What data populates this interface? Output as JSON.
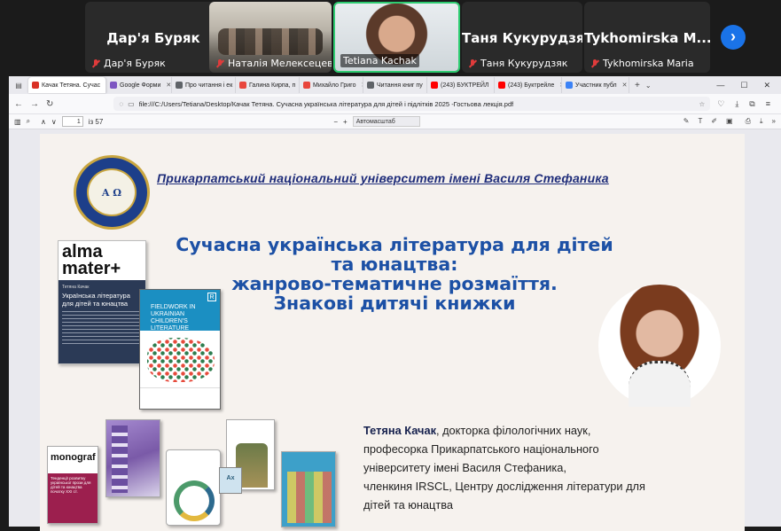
{
  "meeting": {
    "tiles": [
      {
        "display_name": "Дар'я Буряк",
        "caption": "Дар'я Буряк",
        "muted": true
      },
      {
        "display_name": "",
        "caption": "Наталія Мелексецева",
        "muted": true
      },
      {
        "display_name": "",
        "caption": "Tetiana Kachak",
        "muted": false,
        "active": true
      },
      {
        "display_name": "Таня Кукурудзяк",
        "caption": "Таня Кукурудзяк",
        "muted": true
      },
      {
        "display_name": "Tykhomirska M...",
        "caption": "Tykhomirska Maria",
        "muted": true
      }
    ],
    "next_icon": "chevron-right-icon"
  },
  "browser": {
    "tabs": [
      {
        "label": "Качак Тетяна. Сучас",
        "fav_color": "#d93025",
        "active": true
      },
      {
        "label": "Google Форми",
        "fav_color": "#7e57c2"
      },
      {
        "label": "Про читання і ек",
        "fav_color": "#5f6368"
      },
      {
        "label": "Галина Кирпа, п",
        "fav_color": "#e8453c"
      },
      {
        "label": "Михайло Григо",
        "fav_color": "#e8453c"
      },
      {
        "label": "Читання книг пу",
        "fav_color": "#5f6368"
      },
      {
        "label": "(243) БУКТРЕЙЛ",
        "fav_color": "#ff0000"
      },
      {
        "label": "(243) Буктрейле",
        "fav_color": "#ff0000"
      },
      {
        "label": "Участник публ",
        "fav_color": "#3b82f6"
      }
    ],
    "new_tab": "+",
    "url": "file:///C:/Users/Tetiana/Desktop/Качак Тетяна. Сучасна українська література для дітей і підлітків 2025 -Гостьова лекція.pdf",
    "pdf": {
      "page": "1",
      "of_pages": "із 57",
      "zoom_minus": "−",
      "zoom_plus": "+",
      "zoom": "Автомасштаб"
    }
  },
  "slide": {
    "university": "Прикарпатський національний університет імені Василя Стефаника",
    "seal_text": "Α Ω",
    "title_lines": [
      "Сучасна українська література для дітей",
      "та юнацтва:",
      "жанрово-тематичне розмаїття.",
      "Знакові дитячі книжки"
    ],
    "book1": {
      "brand_line1": "alma",
      "brand_line2": "mater+",
      "author": "Тетяна Качак",
      "title": "Українська література для дітей та юнацтва"
    },
    "book2": {
      "title": "Fieldwork in Ukrainian Children's Literature",
      "logo": "R"
    },
    "book_small": {
      "brand": "monograf",
      "title": "Тенденції розвитку української прози для дітей та юнацтва початку XXI ст."
    },
    "book_mini": "Ax",
    "author": {
      "name": "Тетяна Качак",
      "line1_rest": ", докторка філологічних наук,",
      "line2": "професорка Прикарпатського національного",
      "line3": "університету імені Василя Стефаника,",
      "line4": "членкиня  IRSCL, Центру дослідження літератури для",
      "line5": "дітей та юнацтва"
    }
  }
}
